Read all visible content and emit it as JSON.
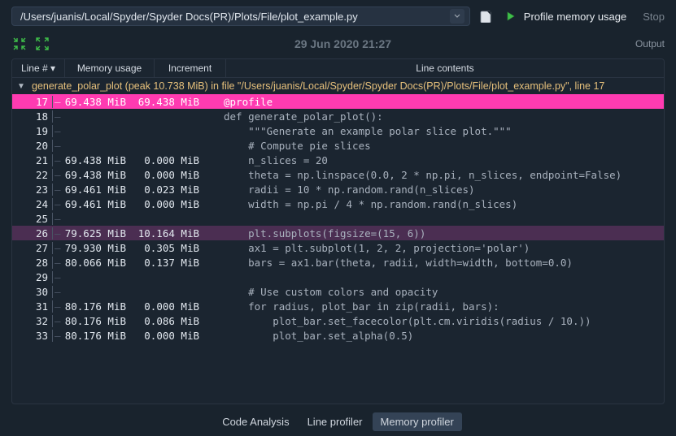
{
  "toolbar": {
    "path": "/Users/juanis/Local/Spyder/Spyder Docs(PR)/Plots/File/plot_example.py",
    "profile_label": "Profile memory usage",
    "stop_label": "Stop"
  },
  "timestamp": "29 Jun 2020 21:27",
  "output_label": "Output",
  "headers": {
    "line": "Line #",
    "mem": "Memory usage",
    "inc": "Increment",
    "contents": "Line contents"
  },
  "function_summary": "generate_polar_plot (peak 10.738 MiB) in file \"/Users/juanis/Local/Spyder/Spyder Docs(PR)/Plots/File/plot_example.py\", line 17",
  "rows": [
    {
      "n": 17,
      "mu": "69.438 MiB",
      "inc": "69.438 MiB",
      "code": "@profile",
      "hl": "pink"
    },
    {
      "n": 18,
      "mu": "",
      "inc": "",
      "code": "def generate_polar_plot():"
    },
    {
      "n": 19,
      "mu": "",
      "inc": "",
      "code": "    \"\"\"Generate an example polar slice plot.\"\"\""
    },
    {
      "n": 20,
      "mu": "",
      "inc": "",
      "code": "    # Compute pie slices"
    },
    {
      "n": 21,
      "mu": "69.438 MiB",
      "inc": "0.000 MiB",
      "code": "    n_slices = 20"
    },
    {
      "n": 22,
      "mu": "69.438 MiB",
      "inc": "0.000 MiB",
      "code": "    theta = np.linspace(0.0, 2 * np.pi, n_slices, endpoint=False)"
    },
    {
      "n": 23,
      "mu": "69.461 MiB",
      "inc": "0.023 MiB",
      "code": "    radii = 10 * np.random.rand(n_slices)"
    },
    {
      "n": 24,
      "mu": "69.461 MiB",
      "inc": "0.000 MiB",
      "code": "    width = np.pi / 4 * np.random.rand(n_slices)"
    },
    {
      "n": 25,
      "mu": "",
      "inc": "",
      "code": ""
    },
    {
      "n": 26,
      "mu": "79.625 MiB",
      "inc": "10.164 MiB",
      "code": "    plt.subplots(figsize=(15, 6))",
      "hl": "purple"
    },
    {
      "n": 27,
      "mu": "79.930 MiB",
      "inc": "0.305 MiB",
      "code": "    ax1 = plt.subplot(1, 2, 2, projection='polar')"
    },
    {
      "n": 28,
      "mu": "80.066 MiB",
      "inc": "0.137 MiB",
      "code": "    bars = ax1.bar(theta, radii, width=width, bottom=0.0)"
    },
    {
      "n": 29,
      "mu": "",
      "inc": "",
      "code": ""
    },
    {
      "n": 30,
      "mu": "",
      "inc": "",
      "code": "    # Use custom colors and opacity"
    },
    {
      "n": 31,
      "mu": "80.176 MiB",
      "inc": "0.000 MiB",
      "code": "    for radius, plot_bar in zip(radii, bars):"
    },
    {
      "n": 32,
      "mu": "80.176 MiB",
      "inc": "0.086 MiB",
      "code": "        plot_bar.set_facecolor(plt.cm.viridis(radius / 10.))"
    },
    {
      "n": 33,
      "mu": "80.176 MiB",
      "inc": "0.000 MiB",
      "code": "        plot_bar.set_alpha(0.5)"
    }
  ],
  "tabs": {
    "code_analysis": "Code Analysis",
    "line_profiler": "Line profiler",
    "memory_profiler": "Memory profiler"
  }
}
